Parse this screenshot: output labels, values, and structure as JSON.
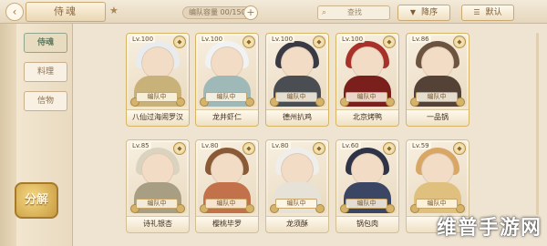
{
  "topbar": {
    "back_icon": "back-arrow-icon",
    "title": "侍魂",
    "star_icon": "star-icon",
    "count_text": "编队容量 00/150",
    "count_plus": "+",
    "search_placeholder": "查找",
    "sort_desc_label": "降序",
    "sort_default_label": "默认"
  },
  "sidebar": {
    "tabs": [
      {
        "label": "侍魂",
        "active": true
      },
      {
        "label": "料理",
        "active": false
      },
      {
        "label": "信物",
        "active": false
      }
    ],
    "assign_label": "分解"
  },
  "cards": [
    {
      "level": "Lv.100",
      "status": "编队中",
      "name": "八仙过海闹罗汉",
      "hair": "#e9ecef",
      "body": "#c9b27a"
    },
    {
      "level": "Lv.100",
      "status": "编队中",
      "name": "龙井虾仁",
      "hair": "#f1f2f3",
      "body": "#9fb9b8"
    },
    {
      "level": "Lv.100",
      "status": "编队中",
      "name": "德州扒鸡",
      "hair": "#3a3a44",
      "body": "#4a4d52"
    },
    {
      "level": "Lv.100",
      "status": "编队中",
      "name": "北京烤鸭",
      "hair": "#a8322a",
      "body": "#7a1f1c"
    },
    {
      "level": "Lv.86",
      "status": "编队中",
      "name": "一品锅",
      "hair": "#6d5440",
      "body": "#554236"
    },
    {
      "level": "Lv.85",
      "status": "编队中",
      "name": "诗礼银杏",
      "hair": "#d9d3c0",
      "body": "#a79e84"
    },
    {
      "level": "Lv.80",
      "status": "编队中",
      "name": "樱桃毕罗",
      "hair": "#8a5a36",
      "body": "#c2714a"
    },
    {
      "level": "Lv.80",
      "status": "编队中",
      "name": "龙须酥",
      "hair": "#f0eeea",
      "body": "#e6e2d8"
    },
    {
      "level": "Lv.60",
      "status": "编队中",
      "name": "锅包肉",
      "hair": "#2e3445",
      "body": "#3a4664"
    },
    {
      "level": "Lv.59",
      "status": "编队中",
      "name": "",
      "hair": "#d8a766",
      "body": "#e0c07e"
    }
  ],
  "watermark": "维普手游网"
}
